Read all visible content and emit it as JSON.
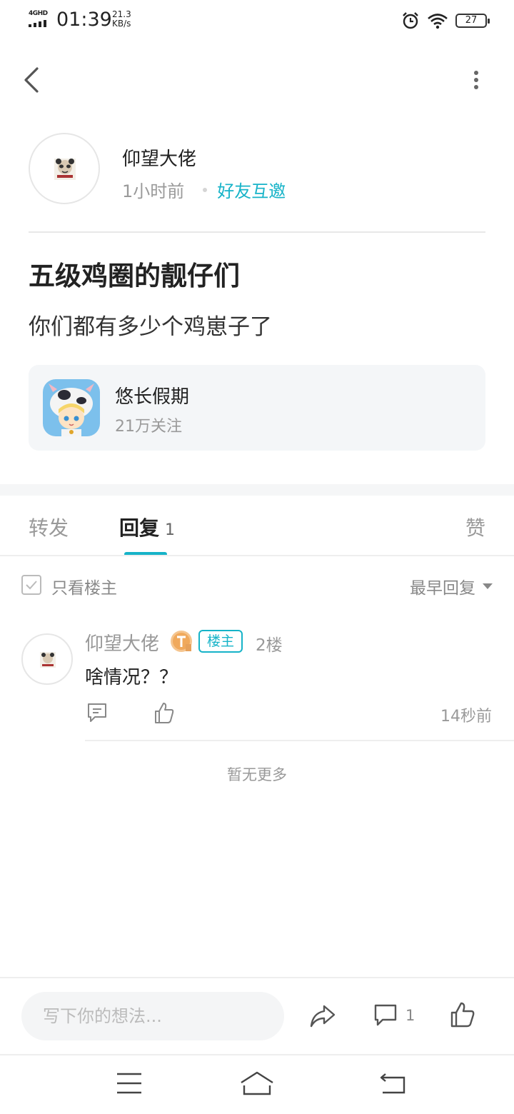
{
  "status_bar": {
    "network": "4GHD",
    "time": "01:39",
    "speed_value": "21.3",
    "speed_unit": "KB/s",
    "battery": "27"
  },
  "nav": {
    "back_icon": "chevron-left-icon",
    "more_icon": "more-vertical-icon"
  },
  "post": {
    "author_name": "仰望大佬",
    "time_ago": "1小时前",
    "tag": "好友互邀",
    "title": "五级鸡圈的靓仔们",
    "body": "你们都有多少个鸡崽子了",
    "game": {
      "name": "悠长假期",
      "followers": "21万关注"
    }
  },
  "tabs": {
    "share": "转发",
    "reply": "回复",
    "reply_count": "1",
    "like": "赞"
  },
  "filter": {
    "only_author": "只看楼主",
    "sort": "最早回复"
  },
  "comments": [
    {
      "name": "仰望大佬",
      "badge": "楼主",
      "floor": "2楼",
      "text": "啥情况？？",
      "time": "14秒前"
    }
  ],
  "no_more": "暂无更多",
  "bottom_bar": {
    "input_placeholder": "写下你的想法...",
    "comment_count": "1"
  },
  "colors": {
    "accent": "#16b3c8",
    "text": "#222222",
    "muted": "#999999"
  }
}
